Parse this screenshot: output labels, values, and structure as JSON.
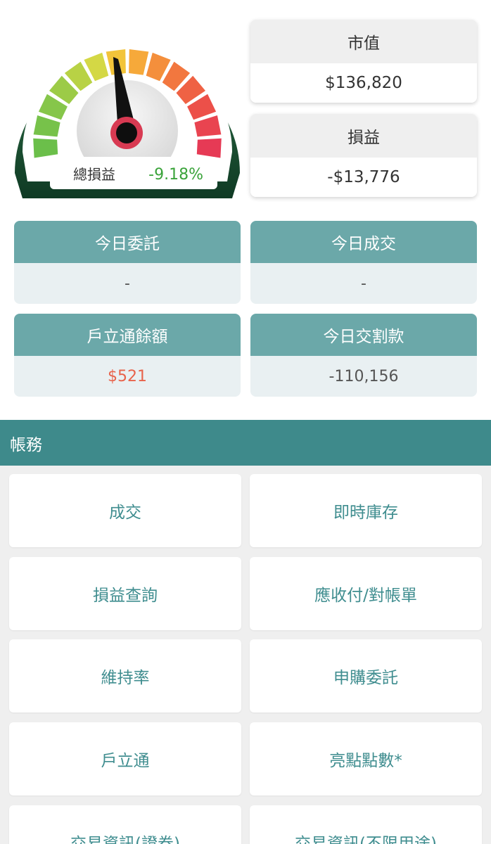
{
  "gauge": {
    "label": "總損益",
    "value": "-9.18%",
    "value_color": "#3aa33a"
  },
  "summary": {
    "market_value": {
      "label": "市值",
      "value": "$136,820"
    },
    "pnl": {
      "label": "損益",
      "value": "-$13,776"
    }
  },
  "stats": {
    "today_orders": {
      "label": "今日委託",
      "value": "-"
    },
    "today_trades": {
      "label": "今日成交",
      "value": "-"
    },
    "account_balance": {
      "label": "戶立通餘額",
      "value": "$521"
    },
    "today_settlement": {
      "label": "今日交割款",
      "value": "-110,156"
    }
  },
  "section": {
    "title": "帳務"
  },
  "menu": {
    "items": [
      "成交",
      "即時庫存",
      "損益查詢",
      "應收付/對帳單",
      "維持率",
      "申購委託",
      "戶立通",
      "亮點點數*",
      "交易資訊(證券)",
      "交易資訊(不限用途)"
    ]
  },
  "colors": {
    "teal_header": "#3e8a8b",
    "teal_card": "#6ba8a9",
    "teal_text": "#3f8d8f",
    "negative_green": "#3aa33a",
    "balance_orange": "#e8634b",
    "gauge_dark_green": "#1f5a3a"
  }
}
